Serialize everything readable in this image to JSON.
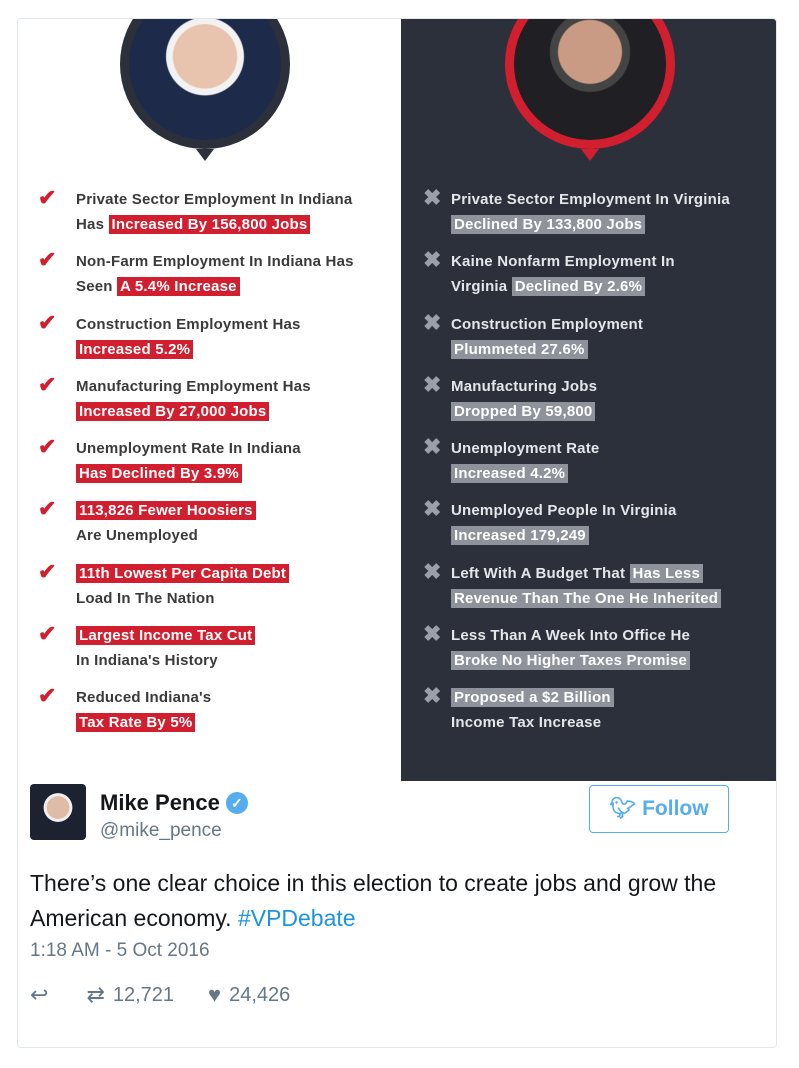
{
  "infographic": {
    "colors": {
      "left_accent": "#d21f2f",
      "right_panel": "#2b303a",
      "right_highlight": "#8d929b"
    },
    "left_items": [
      {
        "l1": {
          "text": "Private Sector Employment In Indiana",
          "hl": ""
        },
        "l2": {
          "text": "Has",
          "hl": "Increased By 156,800 Jobs"
        }
      },
      {
        "l1": {
          "text": "Non-Farm Employment In Indiana Has",
          "hl": ""
        },
        "l2": {
          "text": "Seen",
          "hl": "A 5.4% Increase"
        }
      },
      {
        "l1": {
          "text": "Construction Employment Has",
          "hl": ""
        },
        "l2": {
          "text": "",
          "hl": "Increased 5.2%"
        }
      },
      {
        "l1": {
          "text": "Manufacturing Employment Has",
          "hl": ""
        },
        "l2": {
          "text": "",
          "hl": "Increased By 27,000 Jobs"
        }
      },
      {
        "l1": {
          "text": "Unemployment Rate In Indiana",
          "hl": ""
        },
        "l2": {
          "text": "",
          "hl": "Has Declined By 3.9%"
        }
      },
      {
        "l1": {
          "text": "",
          "hl": "113,826 Fewer Hoosiers"
        },
        "l2": {
          "text": "Are Unemployed",
          "hl": ""
        }
      },
      {
        "l1": {
          "text": "",
          "hl": "11th Lowest Per Capita Debt"
        },
        "l2": {
          "text": "Load In The Nation",
          "hl": ""
        }
      },
      {
        "l1": {
          "text": "",
          "hl": "Largest Income Tax Cut"
        },
        "l2": {
          "text": "In Indiana's History",
          "hl": ""
        }
      },
      {
        "l1": {
          "text": "Reduced Indiana's",
          "hl": ""
        },
        "l2": {
          "text": "",
          "hl": "Tax Rate By 5%"
        }
      }
    ],
    "right_items": [
      {
        "l1": {
          "text": "Private Sector Employment In Virginia",
          "hl": ""
        },
        "l2": {
          "text": "",
          "hl": "Declined By 133,800 Jobs"
        }
      },
      {
        "l1": {
          "text": "Kaine Nonfarm Employment In",
          "hl": ""
        },
        "l2": {
          "text": "Virginia",
          "hl": "Declined By 2.6%"
        }
      },
      {
        "l1": {
          "text": "Construction Employment",
          "hl": ""
        },
        "l2": {
          "text": "",
          "hl": "Plummeted 27.6%"
        }
      },
      {
        "l1": {
          "text": "Manufacturing Jobs",
          "hl": ""
        },
        "l2": {
          "text": "",
          "hl": "Dropped By 59,800"
        }
      },
      {
        "l1": {
          "text": "Unemployment Rate",
          "hl": ""
        },
        "l2": {
          "text": "",
          "hl": "Increased 4.2%"
        }
      },
      {
        "l1": {
          "text": "Unemployed People In Virginia",
          "hl": ""
        },
        "l2": {
          "text": "",
          "hl": "Increased 179,249"
        }
      },
      {
        "l1": {
          "text": "Left With A Budget That",
          "hl": "Has Less"
        },
        "l2": {
          "text": "",
          "hl": "Revenue Than The One He Inherited"
        }
      },
      {
        "l1": {
          "text": "Less Than A Week Into Office He",
          "hl": ""
        },
        "l2": {
          "text": "",
          "hl": "Broke No Higher Taxes Promise"
        }
      },
      {
        "l1": {
          "text": "",
          "hl": "Proposed a $2 Billion"
        },
        "l2": {
          "text": "Income Tax Increase",
          "hl": ""
        }
      }
    ],
    "left_icon": "checkmark-icon",
    "right_icon": "x-icon"
  },
  "tweet": {
    "name": "Mike Pence",
    "handle": "@mike_pence",
    "follow_label": "Follow",
    "text": "There’s one clear choice in this election to create jobs and grow the American economy.",
    "hashtag": "#VPDebate",
    "timestamp": "1:18 AM - 5 Oct 2016",
    "retweets": "12,721",
    "likes": "24,426",
    "link_color": "#1b95e0"
  }
}
